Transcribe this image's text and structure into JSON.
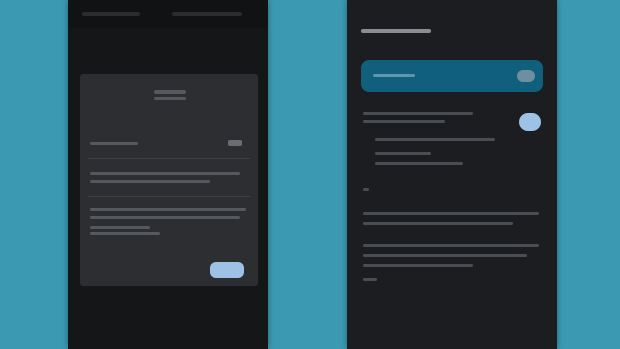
{
  "left_screen": {
    "dialog": {
      "title": "",
      "ok_label": ""
    }
  },
  "right_screen": {
    "title": "",
    "banner": {
      "label": ""
    }
  },
  "colors": {
    "background": "#3b9ab2",
    "surface_dark": "#121314",
    "dialog": "#2c2e31",
    "accent": "#9dc2e6",
    "banner": "#0f5f7d"
  },
  "icons": [
    "toggle-icon"
  ]
}
